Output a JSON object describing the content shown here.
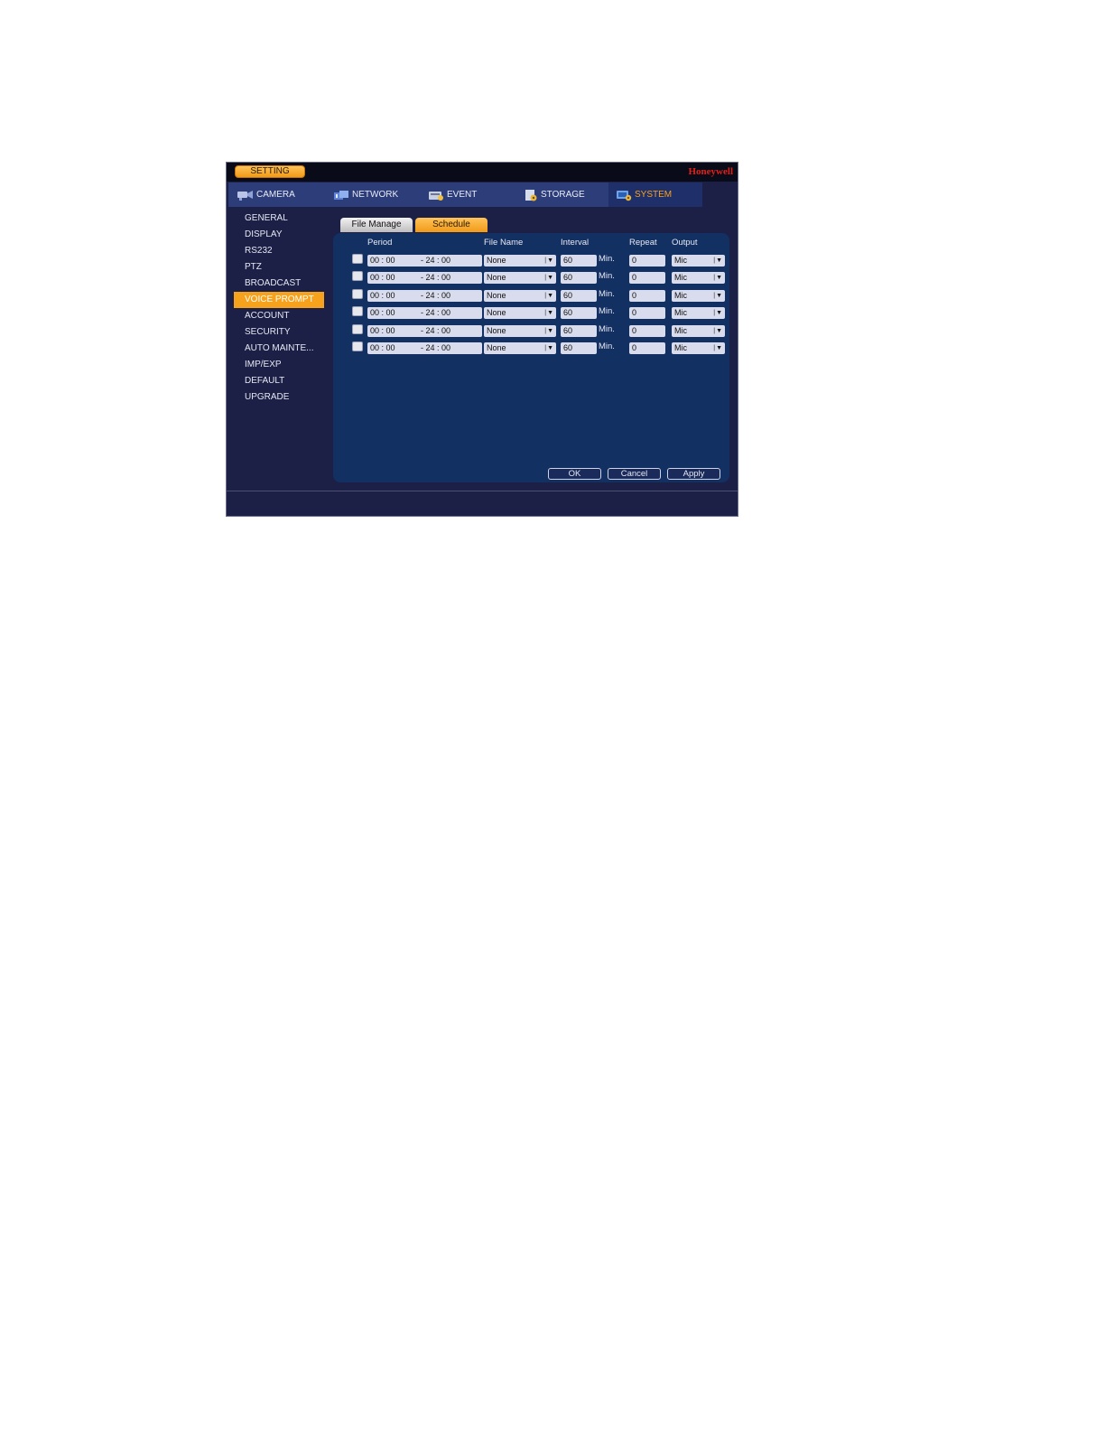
{
  "titlebar": {
    "setting_label": "SETTING",
    "brand": "Honeywell"
  },
  "topnav": {
    "tabs": [
      {
        "label": "CAMERA",
        "icon": "camera-icon"
      },
      {
        "label": "NETWORK",
        "icon": "network-icon"
      },
      {
        "label": "EVENT",
        "icon": "event-icon"
      },
      {
        "label": "STORAGE",
        "icon": "storage-icon"
      },
      {
        "label": "SYSTEM",
        "icon": "system-icon",
        "active": true
      }
    ]
  },
  "sidebar": {
    "items": [
      {
        "label": "GENERAL"
      },
      {
        "label": "DISPLAY"
      },
      {
        "label": "RS232"
      },
      {
        "label": "PTZ"
      },
      {
        "label": "BROADCAST"
      },
      {
        "label": "VOICE PROMPT",
        "active": true
      },
      {
        "label": "ACCOUNT"
      },
      {
        "label": "SECURITY"
      },
      {
        "label": "AUTO MAINTE..."
      },
      {
        "label": "IMP/EXP"
      },
      {
        "label": "DEFAULT"
      },
      {
        "label": "UPGRADE"
      }
    ]
  },
  "subtabs": {
    "file_manage": "File Manage",
    "schedule": "Schedule"
  },
  "table": {
    "headers": {
      "period": "Period",
      "file_name": "File Name",
      "interval": "Interval",
      "repeat": "Repeat",
      "output": "Output"
    },
    "interval_unit": "Min.",
    "rows": [
      {
        "start": "00 : 00",
        "end": "- 24 : 00",
        "file": "None",
        "interval": "60",
        "repeat": "0",
        "output": "Mic"
      },
      {
        "start": "00 : 00",
        "end": "- 24 : 00",
        "file": "None",
        "interval": "60",
        "repeat": "0",
        "output": "Mic"
      },
      {
        "start": "00 : 00",
        "end": "- 24 : 00",
        "file": "None",
        "interval": "60",
        "repeat": "0",
        "output": "Mic"
      },
      {
        "start": "00 : 00",
        "end": "- 24 : 00",
        "file": "None",
        "interval": "60",
        "repeat": "0",
        "output": "Mic"
      },
      {
        "start": "00 : 00",
        "end": "- 24 : 00",
        "file": "None",
        "interval": "60",
        "repeat": "0",
        "output": "Mic"
      },
      {
        "start": "00 : 00",
        "end": "- 24 : 00",
        "file": "None",
        "interval": "60",
        "repeat": "0",
        "output": "Mic"
      }
    ]
  },
  "buttons": {
    "ok": "OK",
    "cancel": "Cancel",
    "apply": "Apply"
  },
  "colors": {
    "accent": "#f7a21c",
    "panel": "#133063",
    "background": "#1c2046",
    "brand": "#e0201b"
  }
}
